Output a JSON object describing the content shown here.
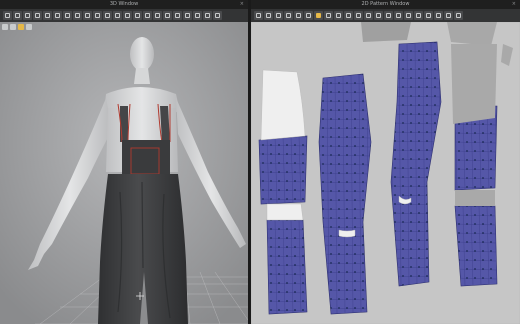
{
  "windows": {
    "view3d_title": "3D Window",
    "view2d_title": "2D Pattern Window",
    "close_glyph": "×"
  },
  "toolbar_3d": {
    "tool_icons": [
      "select-icon",
      "move-icon",
      "rotate-icon",
      "scale-icon",
      "fold-icon",
      "pin-icon",
      "tape-icon",
      "measure-icon",
      "brush-icon",
      "fabric-icon",
      "edit-icon",
      "sew-icon",
      "segment-icon",
      "avatar-icon",
      "light-icon",
      "camera-icon",
      "zoom-icon",
      "view-icon",
      "grid-icon",
      "render-icon",
      "settings-icon",
      "more-icon"
    ]
  },
  "toolbar_2d": {
    "tool_icons": [
      "transform-icon",
      "edit-point-icon",
      "curve-icon",
      "polygon-icon",
      "rectangle-icon",
      "circle-icon",
      "internal-line-icon",
      "dart-icon",
      "notch-icon",
      "segment-sew-icon",
      "free-sew-icon",
      "fold-icon",
      "trace-icon",
      "symmetry-icon",
      "grade-icon",
      "pin-icon",
      "measure-icon",
      "text-icon",
      "zoom-icon",
      "grid-icon",
      "more-icon"
    ]
  },
  "colors": {
    "window_bg_3d": "#9a9b9d",
    "window_bg_2d": "#c9c9c9",
    "pattern_fill": "#5557a8",
    "pattern_mesh": "#3c3f8a",
    "pattern_point": "#1b2a55",
    "overall_fabric": "#3d3e40",
    "stitch_accent": "#b13a2f",
    "avatar_skin": "#d3d4d6",
    "accent_tool": "#e6b847"
  }
}
